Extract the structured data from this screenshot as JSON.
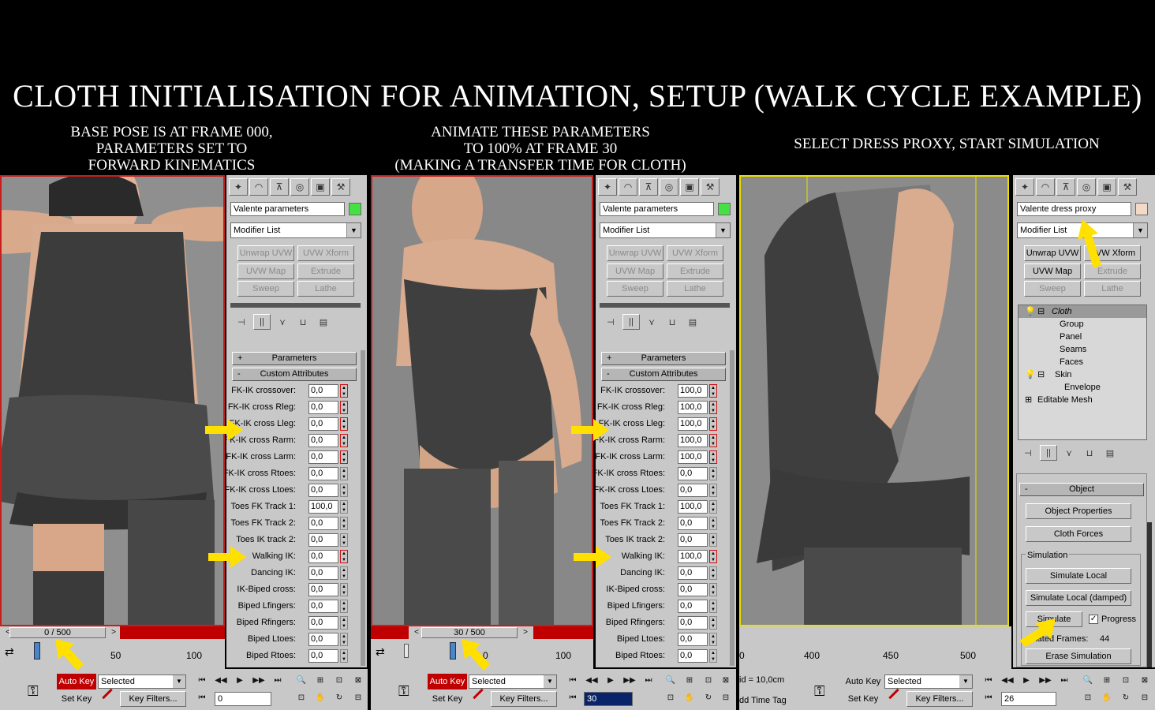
{
  "title": "CLOTH INITIALISATION FOR ANIMATION, SETUP (WALK CYCLE EXAMPLE)",
  "captions": [
    "BASE POSE IS AT FRAME 000,\nPARAMETERS SET TO\nFORWARD KINEMATICS",
    "ANIMATE THESE PARAMETERS\nTO 100% AT FRAME 30\n(MAKING A TRANSFER TIME FOR CLOTH)",
    "SELECT DRESS PROXY, START SIMULATION"
  ],
  "colors": {
    "accent_green": "#44e044",
    "accent_skin": "#f2d9c8",
    "arrow": "#ffe000",
    "autokey_red": "#c00000",
    "selection_yellow": "#e8e000"
  },
  "panel1": {
    "object_name": "Valente parameters",
    "modifier_list": "Modifier List",
    "mod_buttons": [
      "Unwrap UVW",
      "UVW Xform",
      "UVW Map",
      "Extrude",
      "Sweep",
      "Lathe"
    ],
    "rollout_params": "Parameters",
    "rollout_custom": "Custom Attributes",
    "attrs": [
      {
        "label": "FK-IK crossover:",
        "value": "0,0"
      },
      {
        "label": "FK-IK cross Rleg:",
        "value": "0,0"
      },
      {
        "label": "FK-IK cross Lleg:",
        "value": "0,0"
      },
      {
        "label": "FK-IK cross Rarm:",
        "value": "0,0"
      },
      {
        "label": "FK-IK cross Larm:",
        "value": "0,0"
      },
      {
        "label": "FK-IK cross Rtoes:",
        "value": "0,0"
      },
      {
        "label": "FK-IK cross Ltoes:",
        "value": "0,0"
      },
      {
        "label": "Toes FK Track 1:",
        "value": "100,0"
      },
      {
        "label": "Toes FK Track 2:",
        "value": "0,0"
      },
      {
        "label": "Toes IK track 2:",
        "value": "0,0"
      },
      {
        "label": "Walking IK:",
        "value": "0,0"
      },
      {
        "label": "Dancing IK:",
        "value": "0,0"
      },
      {
        "label": "IK-Biped cross:",
        "value": "0,0"
      },
      {
        "label": "Biped Lfingers:",
        "value": "0,0"
      },
      {
        "label": "Biped Rfingers:",
        "value": "0,0"
      },
      {
        "label": "Biped Ltoes:",
        "value": "0,0"
      },
      {
        "label": "Biped Rtoes:",
        "value": "0,0"
      }
    ],
    "time_slider": "0 / 500",
    "time_position": 0.0,
    "ticks": [
      "50",
      "100"
    ]
  },
  "panel2": {
    "object_name": "Valente parameters",
    "modifier_list": "Modifier List",
    "mod_buttons": [
      "Unwrap UVW",
      "UVW Xform",
      "UVW Map",
      "Extrude",
      "Sweep",
      "Lathe"
    ],
    "rollout_params": "Parameters",
    "rollout_custom": "Custom Attributes",
    "attrs": [
      {
        "label": "FK-IK crossover:",
        "value": "100,0"
      },
      {
        "label": "FK-IK cross Rleg:",
        "value": "100,0"
      },
      {
        "label": "FK-IK cross Lleg:",
        "value": "100,0"
      },
      {
        "label": "FK-IK cross Rarm:",
        "value": "100,0"
      },
      {
        "label": "FK-IK cross Larm:",
        "value": "100,0"
      },
      {
        "label": "FK-IK cross Rtoes:",
        "value": "0,0"
      },
      {
        "label": "FK-IK cross Ltoes:",
        "value": "0,0"
      },
      {
        "label": "Toes FK Track 1:",
        "value": "100,0"
      },
      {
        "label": "Toes FK Track 2:",
        "value": "0,0"
      },
      {
        "label": "Toes IK track 2:",
        "value": "0,0"
      },
      {
        "label": "Walking IK:",
        "value": "100,0"
      },
      {
        "label": "Dancing IK:",
        "value": "0,0"
      },
      {
        "label": "IK-Biped cross:",
        "value": "0,0"
      },
      {
        "label": "Biped Lfingers:",
        "value": "0,0"
      },
      {
        "label": "Biped Rfingers:",
        "value": "0,0"
      },
      {
        "label": "Biped Ltoes:",
        "value": "0,0"
      },
      {
        "label": "Biped Rtoes:",
        "value": "0,0"
      }
    ],
    "time_slider": "30 / 500",
    "time_position": 0.06,
    "ticks": [
      "0",
      "100"
    ]
  },
  "panel3": {
    "object_name": "Valente dress proxy",
    "modifier_list": "Modifier List",
    "mod_buttons": [
      "Unwrap UVW",
      "UVW Xform",
      "UVW Map",
      "Extrude",
      "Sweep",
      "Lathe"
    ],
    "stack": [
      {
        "label": "Cloth",
        "level": 0,
        "selected": true
      },
      {
        "label": "Group",
        "level": 1
      },
      {
        "label": "Panel",
        "level": 1
      },
      {
        "label": "Seams",
        "level": 1
      },
      {
        "label": "Faces",
        "level": 1
      },
      {
        "label": "Skin",
        "level": 0
      },
      {
        "label": "Envelope",
        "level": 1
      },
      {
        "label": "Editable Mesh",
        "level": 0
      }
    ],
    "rollout_object": "Object",
    "object_props": "Object Properties",
    "cloth_forces": "Cloth Forces",
    "simulation_group": "Simulation",
    "sim_local": "Simulate Local",
    "sim_local_damped": "Simulate Local (damped)",
    "simulate": "Simulate",
    "progress": "Progress",
    "sim_frames_label": "nulated Frames:",
    "sim_frames_value": "44",
    "erase_sim": "Erase Simulation",
    "ticks": [
      "400",
      "450",
      "500",
      "0"
    ]
  },
  "bottom": {
    "auto_key": "Auto Key",
    "set_key": "Set Key",
    "selected": "Selected",
    "key_filters": "Key Filters...",
    "frame1": "0",
    "frame2": "30",
    "frame3": "26",
    "grid": "id = 10,0cm",
    "time_tag": "dd Time Tag"
  }
}
